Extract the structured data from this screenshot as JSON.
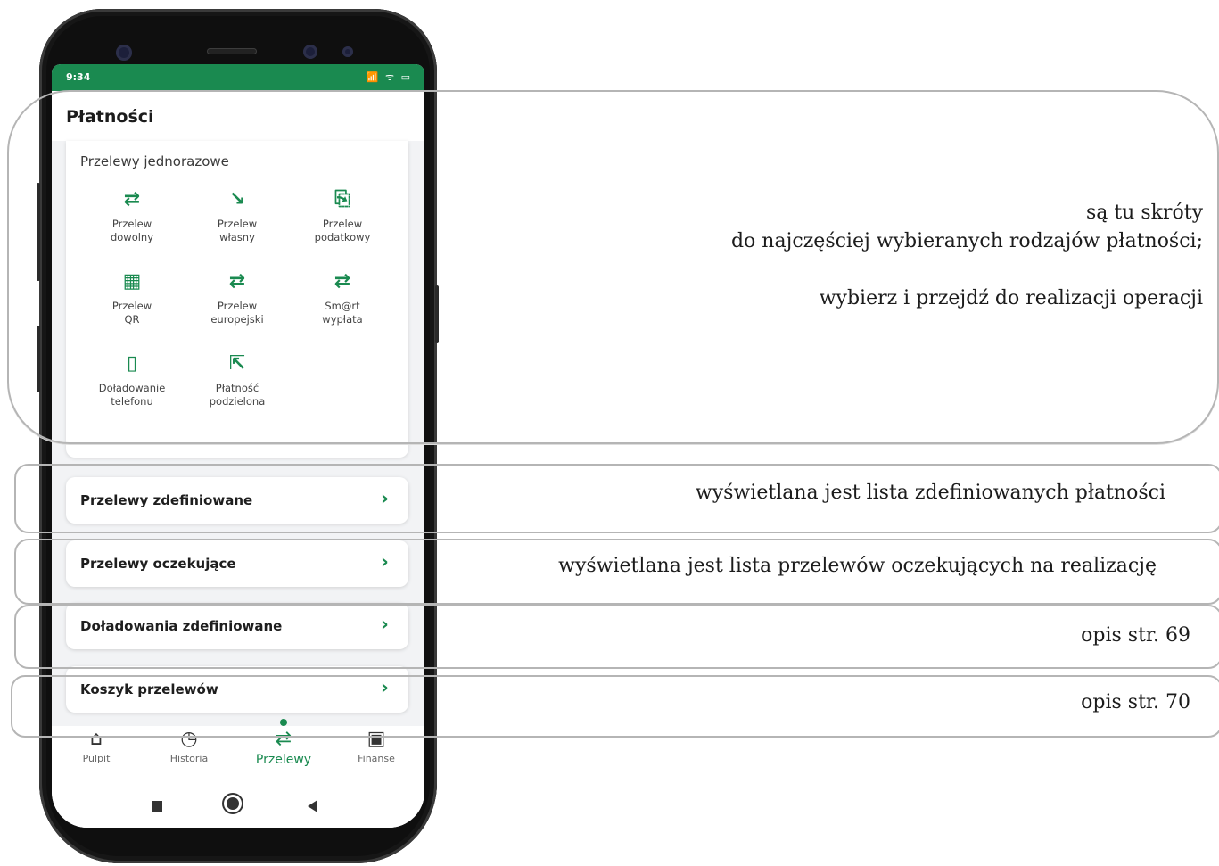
{
  "status_bar": {
    "time": "9:34",
    "icons": "📶 ᯤ ▭"
  },
  "header": {
    "title": "Płatności"
  },
  "one_time_section": {
    "heading": "Przelewy jednorazowe",
    "tiles": [
      {
        "icon": "transfer-arrows-icon",
        "glyph": "⇄",
        "line1": "Przelew",
        "line2": "dowolny"
      },
      {
        "icon": "diagonal-arrow-icon",
        "glyph": "↘",
        "line1": "Przelew",
        "line2": "własny"
      },
      {
        "icon": "tax-document-icon",
        "glyph": "⎘",
        "line1": "Przelew",
        "line2": "podatkowy"
      },
      {
        "icon": "qr-code-icon",
        "glyph": "▦",
        "line1": "Przelew",
        "line2": "QR"
      },
      {
        "icon": "transfer-arrows-icon",
        "glyph": "⇄",
        "line1": "Przelew",
        "line2": "europejski"
      },
      {
        "icon": "transfer-arrows-icon",
        "glyph": "⇄",
        "line1": "Sm@rt",
        "line2": "wypłata"
      },
      {
        "icon": "phone-topup-icon",
        "glyph": "▯",
        "line1": "Doładowanie",
        "line2": "telefonu"
      },
      {
        "icon": "split-payment-icon",
        "glyph": "⇱",
        "line1": "Płatność",
        "line2": "podzielona"
      }
    ]
  },
  "rows": [
    {
      "label": "Przelewy zdefiniowane",
      "chevron": "›"
    },
    {
      "label": "Przelewy oczekujące",
      "chevron": "›"
    },
    {
      "label": "Doładowania zdefiniowane",
      "chevron": "›"
    },
    {
      "label": "Koszyk przelewów",
      "chevron": "›"
    }
  ],
  "tabbar": [
    {
      "label": "Pulpit",
      "glyph": "⌂",
      "icon": "home-icon",
      "active": false
    },
    {
      "label": "Historia",
      "glyph": "◷",
      "icon": "history-icon",
      "active": false
    },
    {
      "label": "Przelewy",
      "glyph": "⇄",
      "icon": "transfer-icon",
      "active": true
    },
    {
      "label": "Finanse",
      "glyph": "▣",
      "icon": "wallet-icon",
      "active": false
    }
  ],
  "annotations": {
    "shortcuts_line1": "są tu skróty",
    "shortcuts_line2": "do najczęściej wybieranych rodzajów płatności;",
    "shortcuts_line3": "wybierz i przejdź do realizacji operacji",
    "defined": "wyświetlana jest lista zdefiniowanych płatności",
    "pending": "wyświetlana jest lista przelewów oczekujących na realizację",
    "topups": "opis str. 69",
    "basket": "opis str. 70"
  },
  "colors": {
    "brand_green": "#1a8a50",
    "frame_gray": "#b5b5b5"
  }
}
